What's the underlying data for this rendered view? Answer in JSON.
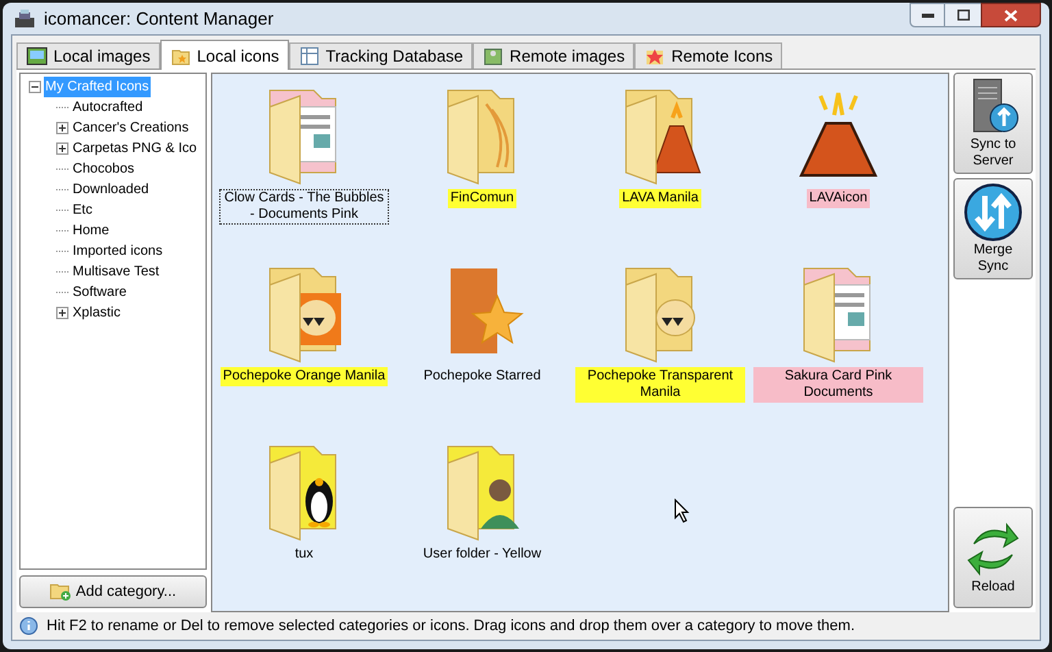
{
  "window": {
    "title": "icomancer: Content Manager"
  },
  "tabs": [
    {
      "label": "Local images",
      "selected": false,
      "kind": "image"
    },
    {
      "label": "Local icons",
      "selected": true,
      "kind": "folder"
    },
    {
      "label": "Tracking Database",
      "selected": false,
      "kind": "database"
    },
    {
      "label": "Remote images",
      "selected": false,
      "kind": "remote-image"
    },
    {
      "label": "Remote Icons",
      "selected": false,
      "kind": "remote-icon"
    }
  ],
  "tree": {
    "label": "My Crafted Icons",
    "selected": true,
    "expanded": true,
    "children": [
      {
        "label": "Autocrafted",
        "selected": false,
        "expandable": false
      },
      {
        "label": "Cancer's Creations",
        "selected": false,
        "expandable": true
      },
      {
        "label": "Carpetas PNG & Ico",
        "selected": false,
        "expandable": true
      },
      {
        "label": "Chocobos",
        "selected": false,
        "expandable": false
      },
      {
        "label": "Downloaded",
        "selected": false,
        "expandable": false
      },
      {
        "label": "Etc",
        "selected": false,
        "expandable": false
      },
      {
        "label": "Home",
        "selected": false,
        "expandable": false
      },
      {
        "label": "Imported icons",
        "selected": false,
        "expandable": false
      },
      {
        "label": "Multisave Test",
        "selected": false,
        "expandable": false
      },
      {
        "label": "Software",
        "selected": false,
        "expandable": false
      },
      {
        "label": "Xplastic",
        "selected": false,
        "expandable": true
      }
    ]
  },
  "add_category_button": "Add category...",
  "icons": [
    {
      "label": "Clow Cards - The Bubbles - Documents Pink",
      "kind": "document-folder",
      "selected": true
    },
    {
      "label": "FinComun",
      "kind": "folder",
      "selected": false,
      "color": "#ffff33"
    },
    {
      "label": "LAVA Manila",
      "kind": "volcano-folder",
      "selected": false,
      "color": "#ffff33"
    },
    {
      "label": "LAVAicon",
      "kind": "volcano",
      "selected": false,
      "color": "#f7bcc8"
    },
    {
      "label": "Pochepoke Orange Manila",
      "kind": "monster-orange-folder",
      "selected": false,
      "color": "#ffff33"
    },
    {
      "label": "Pochepoke Starred",
      "kind": "star-folder",
      "selected": false
    },
    {
      "label": "Pochepoke Transparent Manila",
      "kind": "monster-folder",
      "selected": false,
      "color": "#ffff33"
    },
    {
      "label": "Sakura Card Pink Documents",
      "kind": "document-folder",
      "selected": false,
      "color": "#f7bcc8"
    },
    {
      "label": "tux",
      "kind": "penguin-folder",
      "selected": false
    },
    {
      "label": "User folder - Yellow",
      "kind": "person-folder",
      "selected": false
    }
  ],
  "side_buttons": [
    {
      "label": "Sync to Server",
      "kind": "server"
    },
    {
      "label": "Merge Sync",
      "kind": "merge"
    },
    {
      "label": "Reload",
      "kind": "reload"
    }
  ],
  "status_bar": "Hit F2 to rename or Del to remove selected categories or icons. Drag icons and drop them over a category to move them."
}
